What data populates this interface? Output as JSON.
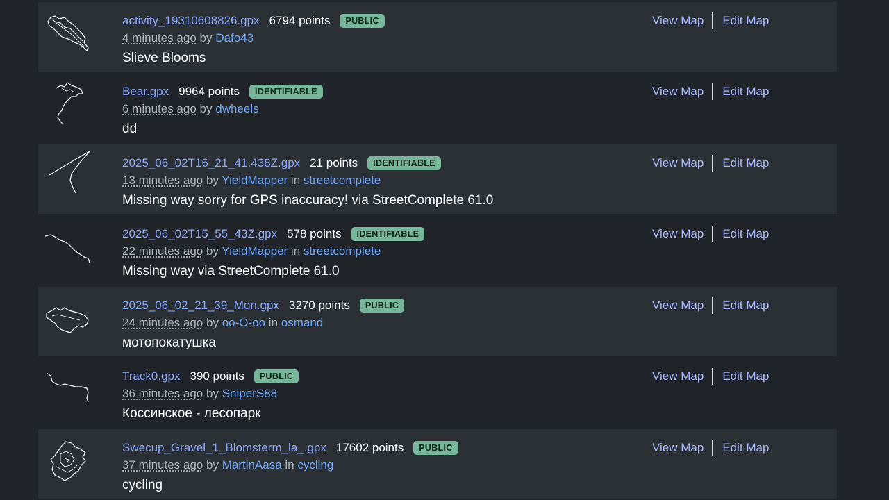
{
  "traces": [
    {
      "filename": "activity_19310608826.gpx",
      "points": "6794 points",
      "badge": "PUBLIC",
      "time": "4 minutes ago",
      "by": "by",
      "user": "Dafo43",
      "in_label": "",
      "tag": "",
      "description": "Slieve Blooms",
      "thumbnail_icon": "track-thumbnail-loop-icon",
      "view_label": "View Map",
      "edit_label": "Edit Map"
    },
    {
      "filename": "Bear.gpx",
      "points": "9964 points",
      "badge": "IDENTIFIABLE",
      "time": "6 minutes ago",
      "by": "by",
      "user": "dwheels",
      "in_label": "",
      "tag": "",
      "description": "dd",
      "thumbnail_icon": "track-thumbnail-squiggle-icon",
      "view_label": "View Map",
      "edit_label": "Edit Map"
    },
    {
      "filename": "2025_06_02T16_21_41.438Z.gpx",
      "points": "21 points",
      "badge": "IDENTIFIABLE",
      "time": "13 minutes ago",
      "by": "by",
      "user": "YieldMapper",
      "in_label": "in",
      "tag": "streetcomplete",
      "description": "Missing way sorry for GPS inaccuracy! via StreetComplete 61.0",
      "thumbnail_icon": "track-thumbnail-vee-icon",
      "view_label": "View Map",
      "edit_label": "Edit Map"
    },
    {
      "filename": "2025_06_02T15_55_43Z.gpx",
      "points": "578 points",
      "badge": "IDENTIFIABLE",
      "time": "22 minutes ago",
      "by": "by",
      "user": "YieldMapper",
      "in_label": "in",
      "tag": "streetcomplete",
      "description": "Missing way via StreetComplete 61.0",
      "thumbnail_icon": "track-thumbnail-curve-icon",
      "view_label": "View Map",
      "edit_label": "Edit Map"
    },
    {
      "filename": "2025_06_02_21_39_Mon.gpx",
      "points": "3270 points",
      "badge": "PUBLIC",
      "time": "24 minutes ago",
      "by": "by",
      "user": "oo-O-oo",
      "in_label": "in",
      "tag": "osmand",
      "description": "мотопокатушка",
      "thumbnail_icon": "track-thumbnail-blob-icon",
      "view_label": "View Map",
      "edit_label": "Edit Map"
    },
    {
      "filename": "Track0.gpx",
      "points": "390 points",
      "badge": "PUBLIC",
      "time": "36 minutes ago",
      "by": "by",
      "user": "SniperS88",
      "in_label": "",
      "tag": "",
      "description": "Коссинское - лесопарк",
      "thumbnail_icon": "track-thumbnail-path-icon",
      "view_label": "View Map",
      "edit_label": "Edit Map"
    },
    {
      "filename": "Swecup_Gravel_1_Blomsterm_la_.gpx",
      "points": "17602 points",
      "badge": "PUBLIC",
      "time": "37 minutes ago",
      "by": "by",
      "user": "MartinAasa",
      "in_label": "in",
      "tag": "cycling",
      "description": "cycling",
      "thumbnail_icon": "track-thumbnail-cluster-icon",
      "view_label": "View Map",
      "edit_label": "Edit Map"
    }
  ]
}
